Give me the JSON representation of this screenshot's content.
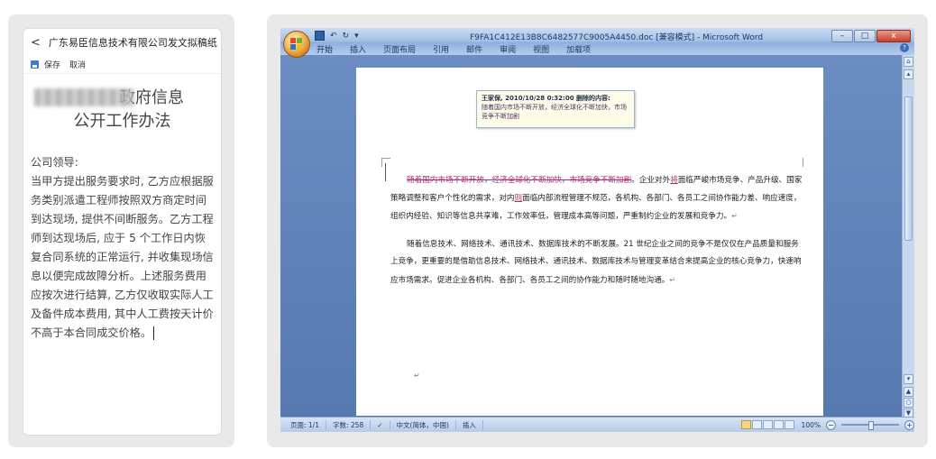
{
  "mobile": {
    "header": {
      "back_glyph": "<",
      "title": "广东易臣信息技术有限公司发文拟稿纸"
    },
    "toolbar": {
      "save_label": "保存",
      "cancel_label": "取消",
      "save_icon": "save-icon"
    },
    "doc_title_visible": "政府信息",
    "doc_title_line2": "公开工作办法",
    "body": "公司领导:\n当甲方提出服务要求时, 乙方应根据服务类别派遣工程师按照双方商定时间到达现场, 提供不间断服务。乙方工程师到达现场后, 应于 5 个工作日内恢复合同系统的正常运行, 并收集现场信息以便完成故障分析。上述服务费用应按次进行结算, 乙方仅收取实际人工及备件成本费用, 其中人工费按天计价不高于本合同成交价格。"
  },
  "word": {
    "title": "F9FA1C412E13B8C6482577C9005A4450.doc [兼容模式] - Microsoft Word",
    "window_buttons": [
      "–",
      "□",
      "x"
    ],
    "tabs": [
      "开始",
      "插入",
      "页面布局",
      "引用",
      "邮件",
      "审阅",
      "视图",
      "加载项"
    ],
    "comment": {
      "header": "王家保, 2010/10/28 0:32:00 删除的内容:",
      "text": "随着国内市场不断开放，经济全球化不断加快，市场竞争不断加剧"
    },
    "paragraph1": {
      "deleted": "随着国内市场不断开放，经济全球化不断加快，市场竞争不断加剧",
      "text_a": "。企业对外",
      "ins1": "将",
      "text_b": "面临严峻市场竞争、产品升级、国家策略调整和客户个性化的需求，对内",
      "ins2": "则",
      "text_c": "面临内部流程管理不规范，各机构、各部门、各员工之间协作能力差、响应速度，组织内经验、知识等信息共享难，工作效率低，管理成本高等问题，严重制约企业的发展和竞争力。"
    },
    "paragraph2": "随着信息技术、网络技术、通讯技术、数据库技术的不断发展。21 世纪企业之间的竞争不是仅仅在产品质量和服务上竞争，更重要的是借助信息技术、网络技术、通讯技术、数据库技术与管理变革结合来提高企业的核心竞争力，快速响应市场需求。促进企业各机构、各部门、各员工之间的协作能力和随时随地沟通。",
    "para_mark": "↵",
    "status": {
      "page": "页面: 1/1",
      "words": "字数: 258",
      "language": "中文(简体，中国)",
      "mode": "插入",
      "zoom": "100%"
    }
  },
  "colors": {
    "revision": "#a8326e",
    "word_blue": "#2d4e7d",
    "accent": "#3c78d8"
  }
}
